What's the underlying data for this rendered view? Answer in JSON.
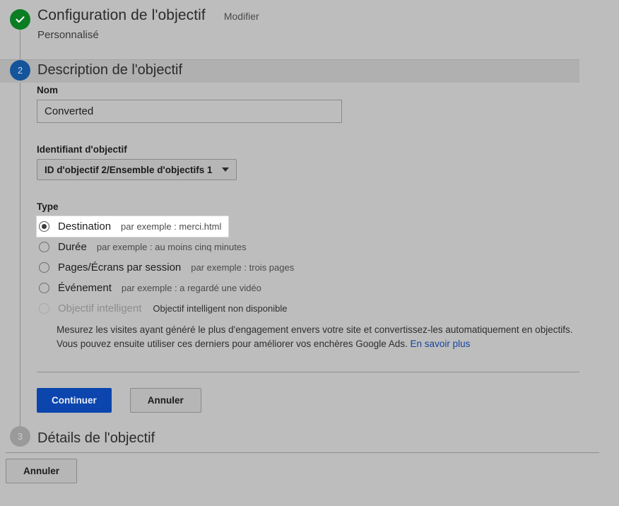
{
  "colors": {
    "page_background": "#bdbdbd",
    "step_done": "#0b7d23",
    "step_active": "#14549b",
    "step_pending": "#9a9a9a",
    "primary_button": "#0b45ad",
    "link": "#14459c"
  },
  "step1": {
    "number_icon": "check-icon",
    "title": "Configuration de l'objectif",
    "edit_label": "Modifier",
    "subtitle": "Personnalisé"
  },
  "step2": {
    "number": "2",
    "title": "Description de l'objectif",
    "name_field": {
      "label": "Nom",
      "value": "Converted",
      "placeholder": ""
    },
    "goal_id_field": {
      "label": "Identifiant d'objectif",
      "selected": "ID d'objectif 2/Ensemble d'objectifs 1",
      "caret_icon": "chevron-down-icon"
    },
    "type_field": {
      "label": "Type",
      "options": [
        {
          "label": "Destination",
          "hint": "par exemple : merci.html",
          "selected": true,
          "disabled": false
        },
        {
          "label": "Durée",
          "hint": "par exemple : au moins cinq minutes",
          "selected": false,
          "disabled": false
        },
        {
          "label": "Pages/Écrans par session",
          "hint": "par exemple : trois pages",
          "selected": false,
          "disabled": false
        },
        {
          "label": "Événement",
          "hint": "par exemple : a regardé une vidéo",
          "selected": false,
          "disabled": false
        },
        {
          "label": "Objectif intelligent",
          "hint": "Objectif intelligent non disponible",
          "selected": false,
          "disabled": true
        }
      ],
      "smart_goal_description_line1": "Mesurez les visites ayant généré le plus d'engagement envers votre site et convertissez-les automatiquement en objectifs.",
      "smart_goal_description_line2": "Vous pouvez ensuite utiliser ces derniers pour améliorer vos enchères Google Ads.",
      "smart_goal_link": "En savoir plus"
    },
    "continue_label": "Continuer",
    "cancel_label": "Annuler"
  },
  "step3": {
    "number": "3",
    "title": "Détails de l'objectif"
  },
  "footer": {
    "cancel_label": "Annuler"
  }
}
